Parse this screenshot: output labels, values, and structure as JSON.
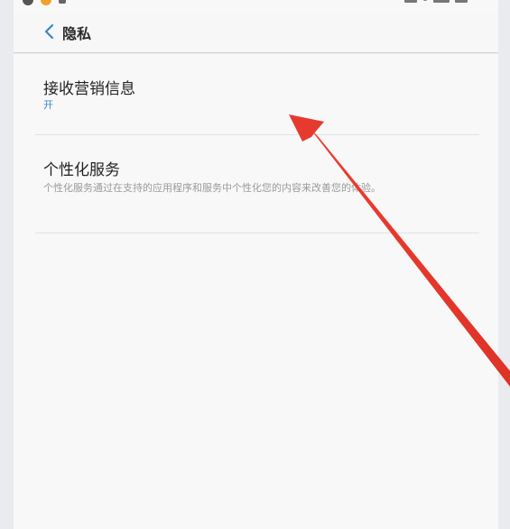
{
  "header": {
    "title": "隐私"
  },
  "settings": [
    {
      "title": "接收营销信息",
      "value": "开"
    },
    {
      "title": "个性化服务",
      "description": "个性化服务通过在支持的应用程序和服务中个性化您的内容来改善您的体验。"
    }
  ],
  "colors": {
    "accent": "#3d87c7",
    "arrow": "#e63a2e",
    "background": "#f8f8f8"
  },
  "icons": {
    "back": "chevron-left-icon"
  }
}
